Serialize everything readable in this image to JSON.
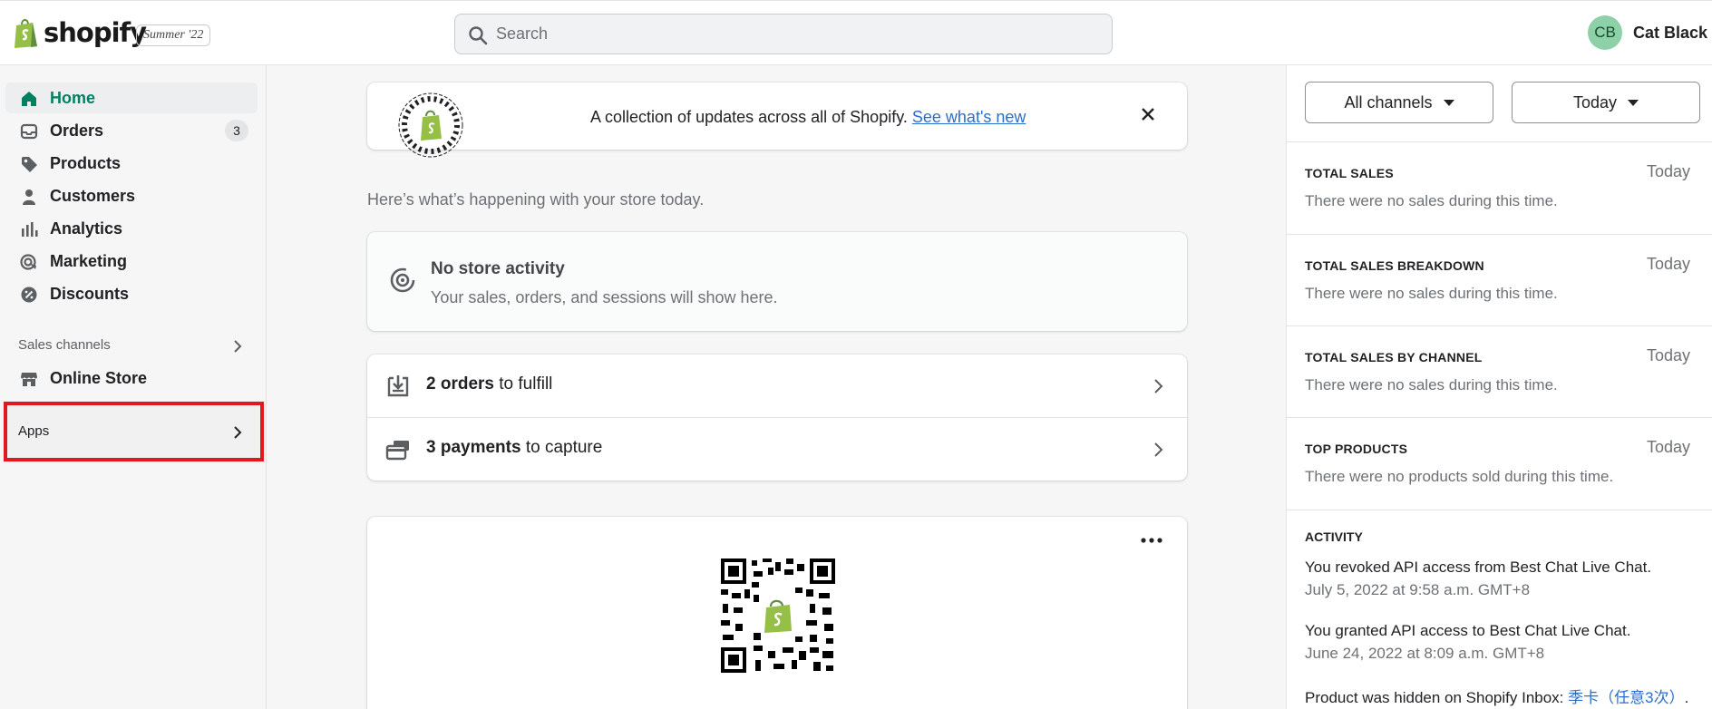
{
  "topbar": {
    "brand": "shopify",
    "edition_badge": "Summer '22",
    "search_placeholder": "Search",
    "user": {
      "initials": "CB",
      "name": "Cat Black"
    }
  },
  "sidebar": {
    "items": [
      {
        "label": "Home",
        "icon": "home-icon",
        "active": true
      },
      {
        "label": "Orders",
        "icon": "inbox-icon",
        "count": "3"
      },
      {
        "label": "Products",
        "icon": "tag-icon"
      },
      {
        "label": "Customers",
        "icon": "person-icon"
      },
      {
        "label": "Analytics",
        "icon": "bar-chart-icon"
      },
      {
        "label": "Marketing",
        "icon": "target-icon"
      },
      {
        "label": "Discounts",
        "icon": "discount-icon"
      }
    ],
    "sales_channels_label": "Sales channels",
    "online_store_label": "Online Store",
    "apps_label": "Apps"
  },
  "banner": {
    "text": "A collection of updates across all of Shopify.",
    "link": "See what's new"
  },
  "intro": "Here’s what’s happening with your store today.",
  "activity": {
    "title": "No store activity",
    "subtitle": "Your sales, orders, and sessions will show here."
  },
  "tasks": [
    {
      "bold": "2 orders",
      "rest": " to fulfill",
      "icon": "download-box-icon"
    },
    {
      "bold": "3 payments",
      "rest": " to capture",
      "icon": "credit-card-icon"
    }
  ],
  "right_panel": {
    "channel_select": "All channels",
    "period_select": "Today",
    "sections": [
      {
        "title": "TOTAL SALES",
        "period": "Today",
        "message": "There were no sales during this time."
      },
      {
        "title": "TOTAL SALES BREAKDOWN",
        "period": "Today",
        "message": "There were no sales during this time."
      },
      {
        "title": "TOTAL SALES BY CHANNEL",
        "period": "Today",
        "message": "There were no sales during this time."
      },
      {
        "title": "TOP PRODUCTS",
        "period": "Today",
        "message": "There were no products sold during this time."
      }
    ],
    "activity_title": "ACTIVITY",
    "activity_log": [
      {
        "text": "You revoked API access from Best Chat Live Chat.",
        "time": "July 5, 2022 at 9:58 a.m. GMT+8"
      },
      {
        "text": "You granted API access to Best Chat Live Chat.",
        "time": "June 24, 2022 at 8:09 a.m. GMT+8"
      },
      {
        "text": "Product was hidden on Shopify Inbox: ",
        "link": "季卡（任意3次）",
        "suffix": "."
      }
    ]
  },
  "colors": {
    "accent_green": "#008060",
    "link_blue": "#2c6ecb",
    "highlight_red": "#e3181f",
    "avatar_bg": "#8ed1a8"
  }
}
